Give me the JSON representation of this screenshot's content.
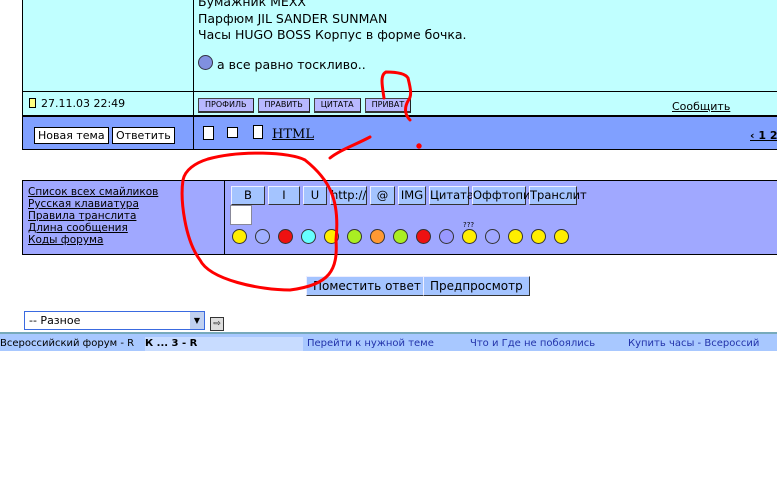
{
  "post": {
    "lines": [
      "Бумажник MEXX",
      "Парфюм JIL SANDER SUNMAN",
      "Часы HUGO BOSS Корпус в форме бочка."
    ],
    "closing": "а все равно тоскливо..",
    "date": "27.11.03 22:49",
    "buttons": [
      "ПРОФИЛЬ",
      "ПРАВИТЬ",
      "ЦИТАТА",
      "ПРИВАТ"
    ],
    "report": "Сообщить Модерат"
  },
  "bar": {
    "new_topic": "Новая тема",
    "reply": "Ответить",
    "html": "HTML",
    "pages": "‹ 1 2"
  },
  "form": {
    "links": [
      "Список всех смайликов",
      "Русская клавиатура",
      "Правила транслита",
      "Длина сообщения",
      "Коды форума"
    ],
    "toolbar": [
      "B",
      "I",
      "U",
      "http://",
      "@",
      "IMG",
      "Цитата",
      "Оффтопик",
      "Транслит"
    ],
    "smileys": [
      "#ffee00",
      "#a0b0ff",
      "#ee1111",
      "#66ffff",
      "#ffee00",
      "#aaee22",
      "#ff9933",
      "#aaee22",
      "#ee1111",
      "#9999ff",
      "#ffee00",
      "#a0a8ff",
      "#ffee00",
      "#ffee00",
      "#ffee00"
    ],
    "confused_label": "???"
  },
  "submit": "Поместить ответ",
  "preview": "Предпросмотр",
  "select": {
    "value": "-- Разное"
  },
  "taskbar": [
    "Всероссийский форум - R",
    "К ... 3 - R",
    "Перейти к нужной теме",
    "Что и Где не побоялись",
    "Купить часы - Всероссий"
  ]
}
